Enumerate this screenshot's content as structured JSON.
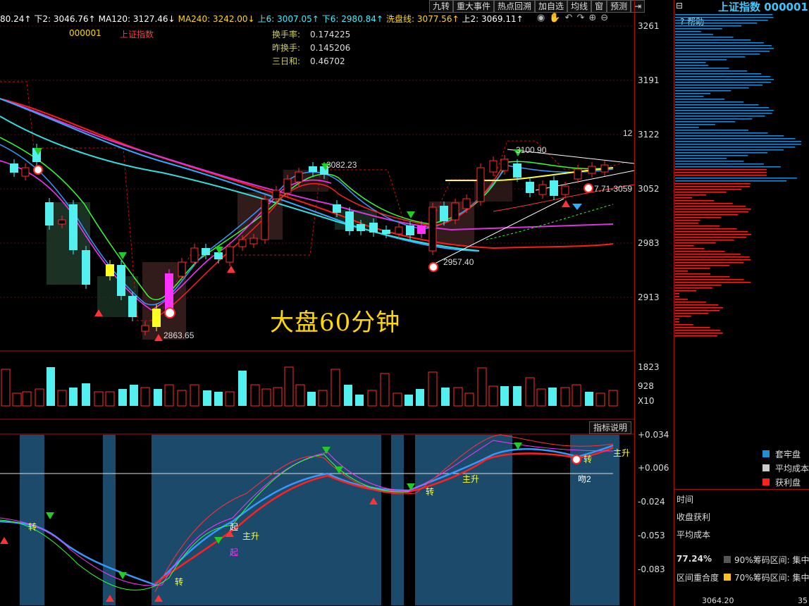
{
  "header": {
    "ma_items": [
      {
        "text": "80.24↑",
        "color": "#ffffff"
      },
      {
        "text": "下2: 3046.76↑",
        "color": "#ffffff"
      },
      {
        "text": "MA120: 3127.46↓",
        "color": "#ffffff"
      },
      {
        "text": "MA240: 3242.00↓",
        "color": "#ffd800"
      },
      {
        "text": "上6: 3007.05↑",
        "color": "#3cf0ff"
      },
      {
        "text": "下6: 2980.84↑",
        "color": "#3cf0ff"
      },
      {
        "text": "洗盘线: 3077.56↑",
        "color": "#ffd800"
      },
      {
        "text": "上2: 3069.11↑",
        "color": "#ffffff"
      }
    ],
    "toolbar": [
      "九转",
      "重大事件",
      "热点回溯",
      "加自选",
      "均线",
      "窗",
      "预测"
    ],
    "icons": [
      "eye-icon",
      "hand-icon",
      "undo-icon",
      "redo-icon",
      "zoom-in-icon",
      "zoom-out-icon"
    ],
    "stock_code": "000001",
    "stock_name": "上证指数"
  },
  "turnover": {
    "rows": [
      {
        "label": "换手率:",
        "value": "0.174225"
      },
      {
        "label": "昨换手:",
        "value": "0.145206"
      },
      {
        "label": "三日和:",
        "value": "0.46702"
      }
    ]
  },
  "main_chart": {
    "title": "大盘60分钟",
    "price_ticks": [
      "3261",
      "3191",
      "3122",
      "3052",
      "2983",
      "2913"
    ],
    "annotations": {
      "high1": "3082.23",
      "high2": "3100.90",
      "low1": "2957.40",
      "low2": "2863.65",
      "mark": "7.71-3059",
      "corner": "12"
    }
  },
  "volume_chart": {
    "ticks": [
      "1823",
      "928",
      "X10"
    ]
  },
  "indicator_chart": {
    "button": "指标说明",
    "ticks": [
      "+0.034",
      "+0.006",
      "-0.024",
      "-0.053",
      "-0.083"
    ],
    "labels": [
      "主升",
      "吻2",
      "起",
      "起",
      "主升",
      "转",
      "转",
      "转",
      "主升",
      "转"
    ]
  },
  "sidebar": {
    "title": "上证指数 000001",
    "help": "帮助",
    "legend": [
      {
        "label": "套牢盘",
        "color": "#1e8fd8"
      },
      {
        "label": "平均成本",
        "color": "#cccccc"
      },
      {
        "label": "获利盘",
        "color": "#ff2020"
      }
    ],
    "info_labels": [
      "时间",
      "收盘获利",
      "平均成本"
    ],
    "percent": "77.24%",
    "range_90": "90%筹码区间: 集中",
    "range_70": "70%筹码区间: 集中",
    "overlap_label": "区间重合度",
    "bottom_price": "3064.20",
    "bottom_right": "35"
  }
}
